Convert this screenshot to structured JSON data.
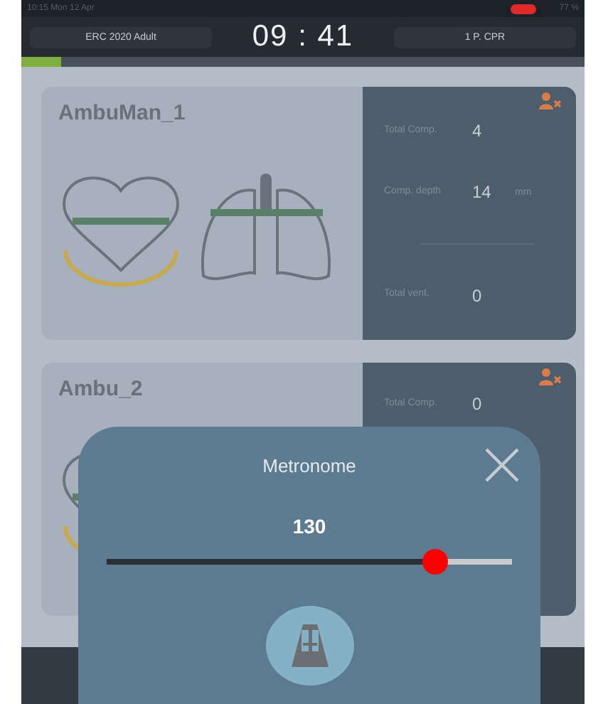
{
  "status_bar": {
    "time": "10:15 Mon 12 Apr",
    "battery": "77 %"
  },
  "header": {
    "protocol": "ERC 2020 Adult",
    "timer": "09 : 41",
    "mode": "1 P. CPR",
    "progress": {
      "level": 0.07
    }
  },
  "manikins": [
    {
      "name": "AmbuMan_1",
      "stats": [
        {
          "label": "Total Comp.",
          "value": "4"
        },
        {
          "label": "Comp. depth",
          "value": "14",
          "unit": "mm"
        },
        {
          "label": "Total vent.",
          "value": "0"
        }
      ]
    },
    {
      "name": "Ambu_2",
      "stats": [
        {
          "label": "Total Comp.",
          "value": "0"
        }
      ]
    }
  ],
  "metronome": {
    "title": "Metronome",
    "value": "130",
    "slider": {
      "level": 0.81
    }
  }
}
